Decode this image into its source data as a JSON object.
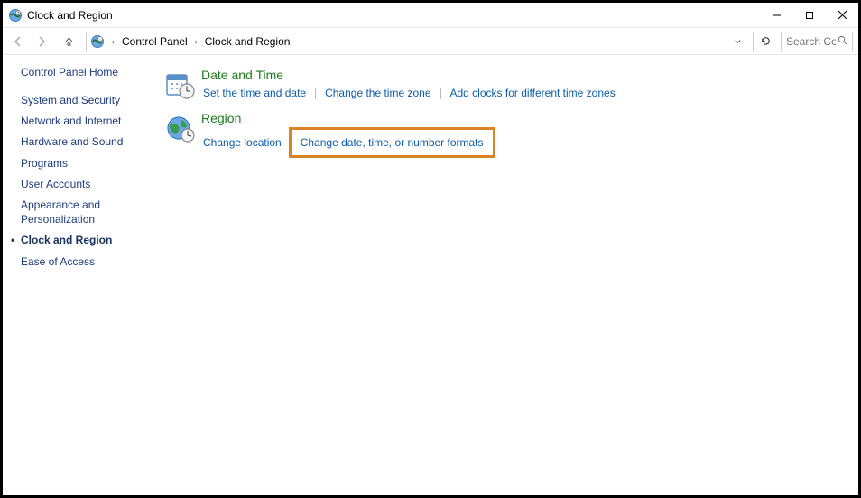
{
  "window": {
    "title": "Clock and Region"
  },
  "breadcrumb": {
    "items": [
      "Control Panel",
      "Clock and Region"
    ]
  },
  "search": {
    "placeholder": "Search Co..."
  },
  "sidebar": {
    "home": "Control Panel Home",
    "items": [
      {
        "label": "System and Security"
      },
      {
        "label": "Network and Internet"
      },
      {
        "label": "Hardware and Sound"
      },
      {
        "label": "Programs"
      },
      {
        "label": "User Accounts"
      },
      {
        "label": "Appearance and Personalization"
      },
      {
        "label": "Clock and Region",
        "active": true
      },
      {
        "label": "Ease of Access"
      }
    ]
  },
  "content": {
    "categories": [
      {
        "title": "Date and Time",
        "links": [
          {
            "label": "Set the time and date"
          },
          {
            "label": "Change the time zone"
          },
          {
            "label": "Add clocks for different time zones"
          }
        ]
      },
      {
        "title": "Region",
        "links": [
          {
            "label": "Change location"
          },
          {
            "label": "Change date, time, or number formats",
            "highlighted": true
          }
        ]
      }
    ]
  }
}
